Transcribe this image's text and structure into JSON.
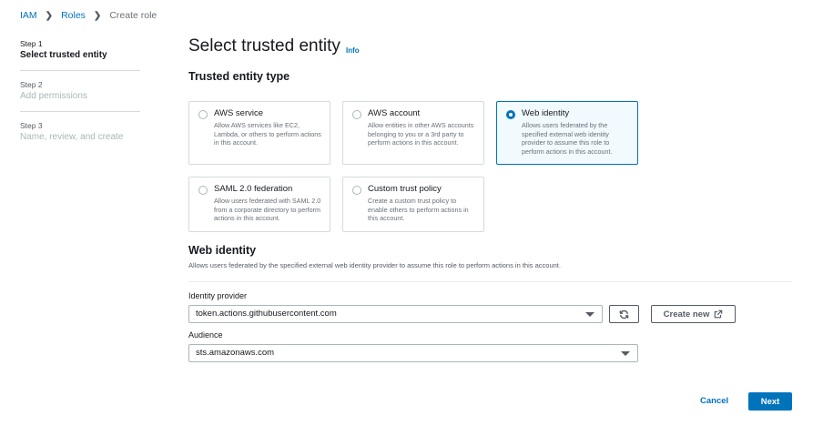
{
  "breadcrumb": {
    "items": [
      "IAM",
      "Roles",
      "Create role"
    ]
  },
  "steps": [
    {
      "num": "Step 1",
      "title": "Select trusted entity",
      "active": true
    },
    {
      "num": "Step 2",
      "title": "Add permissions",
      "active": false
    },
    {
      "num": "Step 3",
      "title": "Name, review, and create",
      "active": false
    }
  ],
  "page": {
    "title": "Select trusted entity",
    "info": "Info"
  },
  "entity_type": {
    "heading": "Trusted entity type",
    "selected": "Web identity",
    "options": [
      {
        "title": "AWS service",
        "desc": "Allow AWS services like EC2, Lambda, or others to perform actions in this account."
      },
      {
        "title": "AWS account",
        "desc": "Allow entities in other AWS accounts belonging to you or a 3rd party to perform actions in this account."
      },
      {
        "title": "Web identity",
        "desc": "Allows users federated by the specified external web identity provider to assume this role to perform actions in this account."
      },
      {
        "title": "SAML 2.0 federation",
        "desc": "Allow users federated with SAML 2.0 from a corporate directory to perform actions in this account."
      },
      {
        "title": "Custom trust policy",
        "desc": "Create a custom trust policy to enable others to perform actions in this account."
      }
    ]
  },
  "web_identity": {
    "heading": "Web identity",
    "description": "Allows users federated by the specified external web identity provider to assume this role to perform actions in this account.",
    "provider_label": "Identity provider",
    "provider_value": "token.actions.githubusercontent.com",
    "audience_label": "Audience",
    "audience_value": "sts.amazonaws.com",
    "create_new_label": "Create new"
  },
  "footer": {
    "cancel_label": "Cancel",
    "next_label": "Next"
  },
  "colors": {
    "link": "#0073bb",
    "primary_button": "#0073bb",
    "selected_tile_bg": "#f1faff"
  },
  "icons": [
    "chevron-right-icon",
    "refresh-icon",
    "external-link-icon",
    "caret-down-icon"
  ]
}
